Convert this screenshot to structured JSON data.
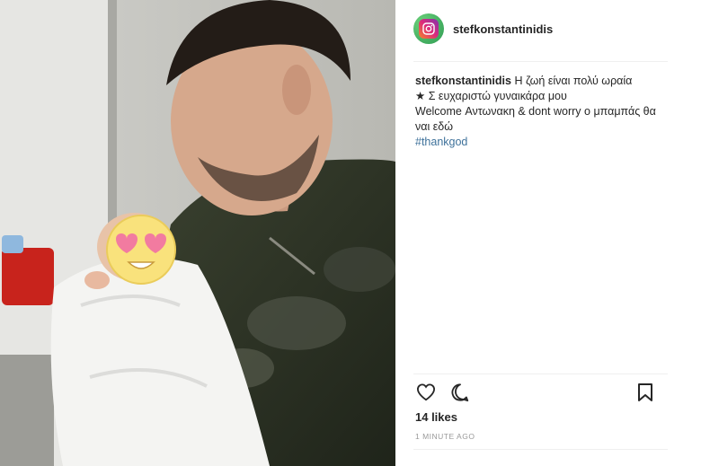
{
  "post": {
    "username": "stefkonstantinidis",
    "caption": {
      "username": "stefkonstantinidis",
      "line1": "Η ζωή είναι πολύ ωραία",
      "line2_icon": "star-icon",
      "line2": "Σ ευχαριστώ γυναικάρα μου",
      "line3": "Welcome Αντωνακη & dont worry ο μπαμπάς θα ναι εδώ",
      "hashtag": "#thankgod"
    },
    "likes": "14 likes",
    "timestamp": "1 MINUTE AGO",
    "icons": {
      "like": "heart-icon",
      "comment": "comment-icon",
      "save": "bookmark-icon"
    }
  },
  "photo": {
    "description_icon": "heart-eyes-emoji"
  },
  "colors": {
    "hashtag": "#3f729b",
    "jacket": "#2f3528",
    "avatar_ring": "#3aa65d"
  }
}
